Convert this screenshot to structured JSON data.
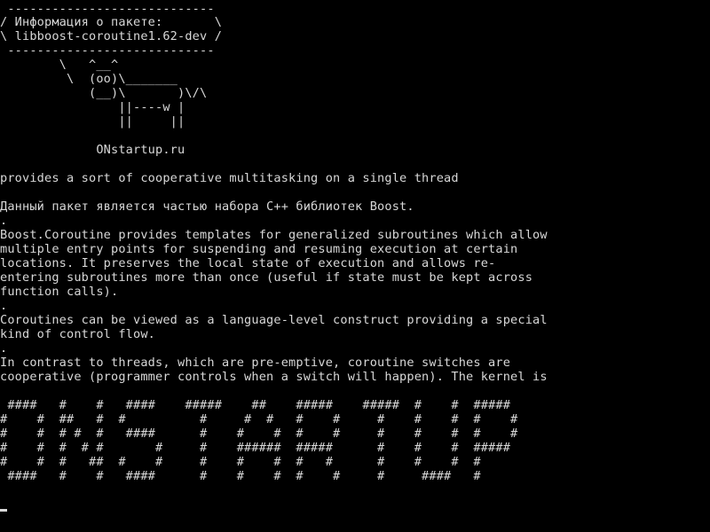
{
  "colors": {
    "background": "#000000",
    "foreground": "#d8d8d8"
  },
  "terminal": {
    "banner": {
      "border_top": " ---------------------------- ",
      "title_line": "/ Информация о пакете:       \\",
      "package_line": "\\ libboost-coroutine1.62-dev /",
      "border_bottom": " ---------------------------- "
    },
    "cow": [
      "        \\   ^__^",
      "         \\  (oo)\\_______",
      "            (__)\\       )\\/\\",
      "                ||----w |",
      "                ||     ||"
    ],
    "site": "             ONstartup.ru",
    "summary": "provides a sort of cooperative multitasking on a single thread",
    "description": [
      "Данный пакет является частью набора C++ библиотек Boost.",
      ".",
      "Boost.Coroutine provides templates for generalized subroutines which allow",
      "multiple entry points for suspending and resuming execution at certain",
      "locations. It preserves the local state of execution and allows re-",
      "entering subroutines more than once (useful if state must be kept across",
      "function calls).",
      ".",
      "Coroutines can be viewed as a language-level construct providing a special",
      "kind of control flow.",
      ".",
      "In contrast to threads, which are pre-emptive, coroutine switches are",
      "cooperative (programmer controls when a switch will happen). The kernel is"
    ],
    "ascii_art": [
      " ####   #    #   ####    #####    ##    #####    #####  #    #  #####",
      "#    #  ##   #  #          #     #  #   #    #     #    #    #  #    #",
      "#    #  # #  #   ####      #    #    #  #    #     #    #    #  #    #",
      "#    #  #  # #       #     #    ######  #####      #    #    #  #####",
      "#    #  #   ##  #    #     #    #    #  #   #      #    #    #  #",
      " ####   #    #   ####      #    #    #  #    #     #     ####   #"
    ]
  }
}
